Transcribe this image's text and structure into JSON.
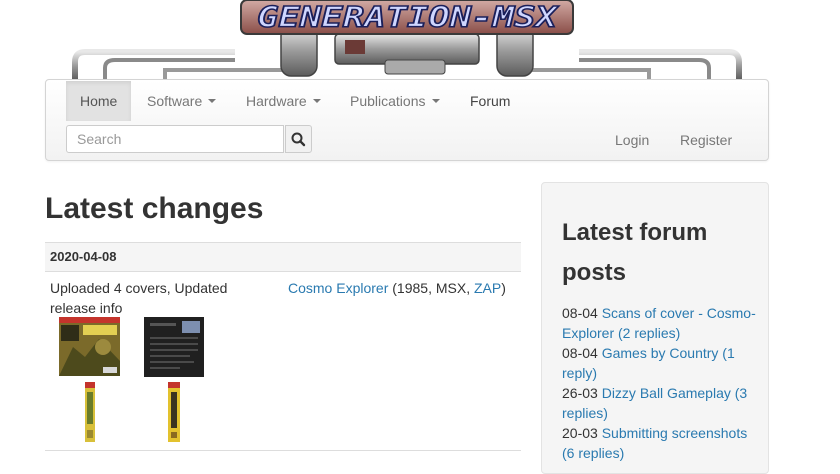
{
  "banner": {
    "logo_text": "GENERATION-MSX"
  },
  "nav": {
    "items": [
      {
        "label": "Home"
      },
      {
        "label": "Software"
      },
      {
        "label": "Hardware"
      },
      {
        "label": "Publications"
      },
      {
        "label": "Forum"
      }
    ],
    "search_placeholder": "Search",
    "login": "Login",
    "register": "Register"
  },
  "main": {
    "title": "Latest changes",
    "entries": [
      {
        "date": "2020-04-08",
        "description": "Uploaded 4 covers,  Updated release info",
        "title_link": "Cosmo Explorer",
        "title_info": " (1985, MSX, ",
        "publisher_link": "ZAP",
        "title_close": ")"
      }
    ]
  },
  "sidebar": {
    "title": "Latest forum posts",
    "posts": [
      {
        "date": "08-04",
        "title": "Scans of cover - Cosmo-Explorer (2 replies)"
      },
      {
        "date": "08-04",
        "title": "Games by Country (1 reply)"
      },
      {
        "date": "26-03",
        "title": "Dizzy Ball Gameplay (3 replies)"
      },
      {
        "date": "20-03",
        "title": "Submitting screenshots (6 replies)"
      }
    ]
  },
  "colors": {
    "link": "#2a7ab0",
    "text": "#333333",
    "navbar_bg": "#f2f2f2"
  }
}
